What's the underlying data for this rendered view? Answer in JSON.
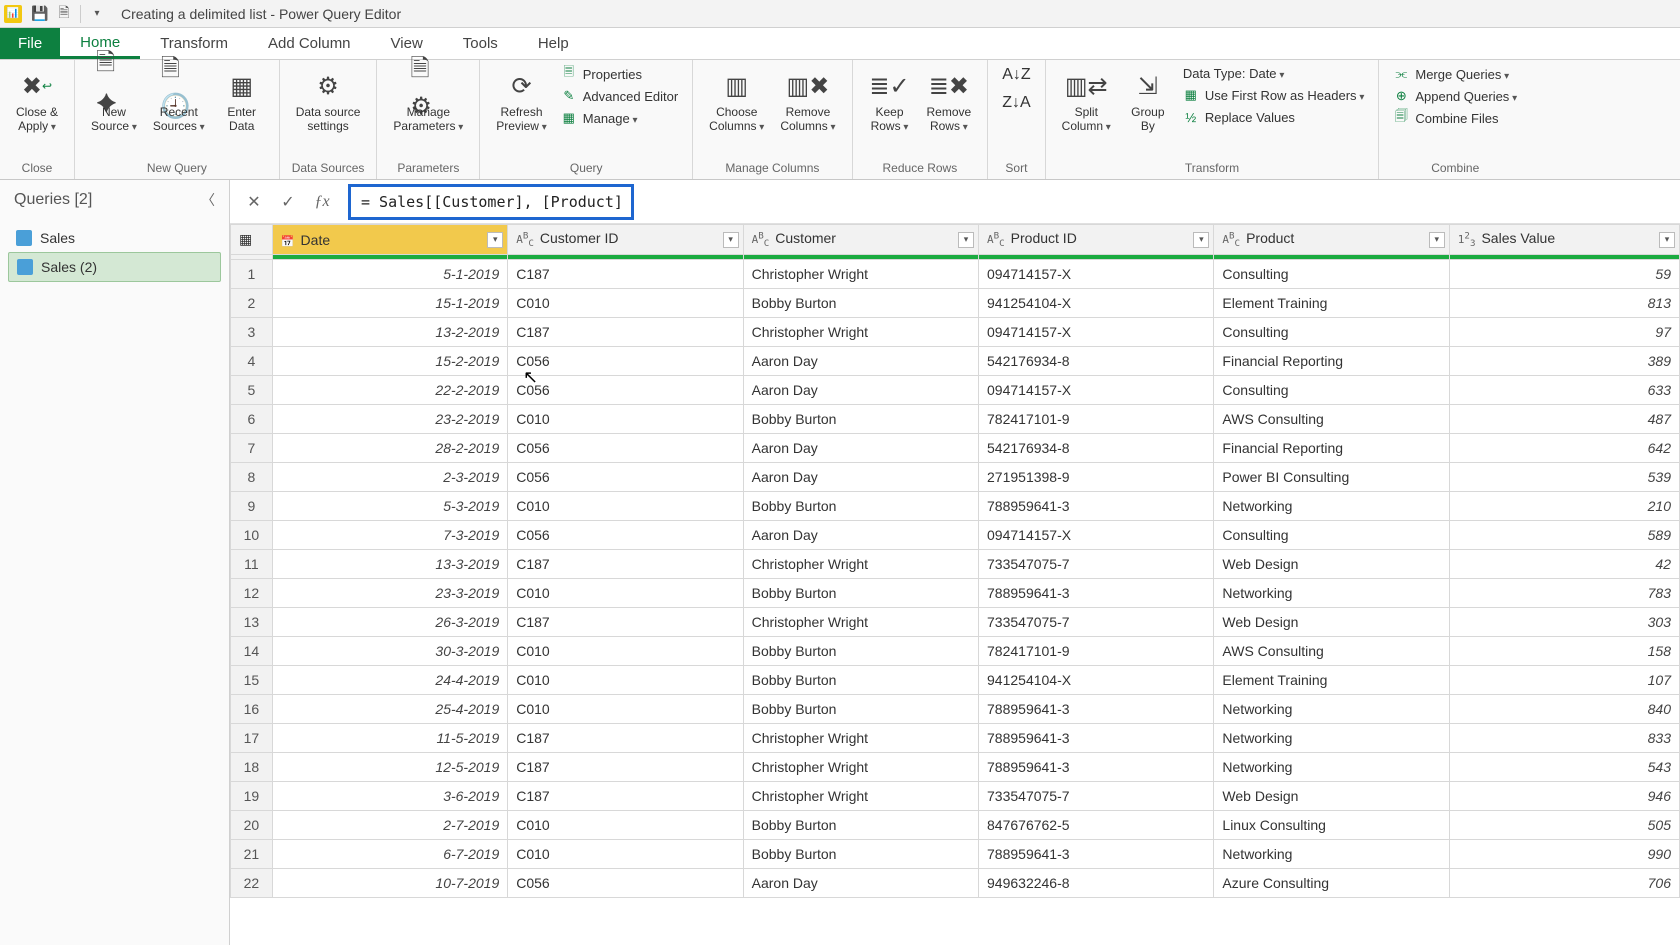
{
  "title": "Creating a delimited list - Power Query Editor",
  "menu": {
    "file": "File",
    "home": "Home",
    "transform": "Transform",
    "addcol": "Add Column",
    "view": "View",
    "tools": "Tools",
    "help": "Help"
  },
  "ribbon": {
    "close_apply": "Close &\nApply",
    "new_source": "New\nSource",
    "recent_sources": "Recent\nSources",
    "enter_data": "Enter\nData",
    "ds_settings": "Data source\nsettings",
    "manage_params": "Manage\nParameters",
    "refresh": "Refresh\nPreview",
    "properties": "Properties",
    "adv_editor": "Advanced Editor",
    "manage": "Manage",
    "choose_cols": "Choose\nColumns",
    "remove_cols": "Remove\nColumns",
    "keep_rows": "Keep\nRows",
    "remove_rows": "Remove\nRows",
    "sort_asc": "",
    "sort_desc": "",
    "split_col": "Split\nColumn",
    "group_by": "Group\nBy",
    "datatype": "Data Type: Date",
    "first_row": "Use First Row as Headers",
    "replace": "Replace Values",
    "merge": "Merge Queries",
    "append": "Append Queries",
    "combine_files": "Combine Files",
    "g_close": "Close",
    "g_newq": "New Query",
    "g_ds": "Data Sources",
    "g_params": "Parameters",
    "g_query": "Query",
    "g_mc": "Manage Columns",
    "g_rr": "Reduce Rows",
    "g_sort": "Sort",
    "g_trans": "Transform",
    "g_combine": "Combine"
  },
  "queries": {
    "header": "Queries [2]",
    "items": [
      "Sales",
      "Sales (2)"
    ],
    "selected": 1
  },
  "formula": "= Sales[[Customer], [Product]]",
  "columns": [
    {
      "key": "date",
      "label": "Date",
      "type": "date",
      "selected": true
    },
    {
      "key": "custid",
      "label": "Customer ID",
      "type": "text"
    },
    {
      "key": "cust",
      "label": "Customer",
      "type": "text"
    },
    {
      "key": "prodid",
      "label": "Product ID",
      "type": "text"
    },
    {
      "key": "prod",
      "label": "Product",
      "type": "text"
    },
    {
      "key": "val",
      "label": "Sales Value",
      "type": "int"
    }
  ],
  "rows": [
    {
      "n": 1,
      "date": "5-1-2019",
      "custid": "C187",
      "cust": "Christopher Wright",
      "prodid": "094714157-X",
      "prod": "Consulting",
      "val": "59"
    },
    {
      "n": 2,
      "date": "15-1-2019",
      "custid": "C010",
      "cust": "Bobby Burton",
      "prodid": "941254104-X",
      "prod": "Element Training",
      "val": "813"
    },
    {
      "n": 3,
      "date": "13-2-2019",
      "custid": "C187",
      "cust": "Christopher Wright",
      "prodid": "094714157-X",
      "prod": "Consulting",
      "val": "97"
    },
    {
      "n": 4,
      "date": "15-2-2019",
      "custid": "C056",
      "cust": "Aaron Day",
      "prodid": "542176934-8",
      "prod": "Financial Reporting",
      "val": "389"
    },
    {
      "n": 5,
      "date": "22-2-2019",
      "custid": "C056",
      "cust": "Aaron Day",
      "prodid": "094714157-X",
      "prod": "Consulting",
      "val": "633"
    },
    {
      "n": 6,
      "date": "23-2-2019",
      "custid": "C010",
      "cust": "Bobby Burton",
      "prodid": "782417101-9",
      "prod": "AWS Consulting",
      "val": "487"
    },
    {
      "n": 7,
      "date": "28-2-2019",
      "custid": "C056",
      "cust": "Aaron Day",
      "prodid": "542176934-8",
      "prod": "Financial Reporting",
      "val": "642"
    },
    {
      "n": 8,
      "date": "2-3-2019",
      "custid": "C056",
      "cust": "Aaron Day",
      "prodid": "271951398-9",
      "prod": "Power BI Consulting",
      "val": "539"
    },
    {
      "n": 9,
      "date": "5-3-2019",
      "custid": "C010",
      "cust": "Bobby Burton",
      "prodid": "788959641-3",
      "prod": "Networking",
      "val": "210"
    },
    {
      "n": 10,
      "date": "7-3-2019",
      "custid": "C056",
      "cust": "Aaron Day",
      "prodid": "094714157-X",
      "prod": "Consulting",
      "val": "589"
    },
    {
      "n": 11,
      "date": "13-3-2019",
      "custid": "C187",
      "cust": "Christopher Wright",
      "prodid": "733547075-7",
      "prod": "Web Design",
      "val": "42"
    },
    {
      "n": 12,
      "date": "23-3-2019",
      "custid": "C010",
      "cust": "Bobby Burton",
      "prodid": "788959641-3",
      "prod": "Networking",
      "val": "783"
    },
    {
      "n": 13,
      "date": "26-3-2019",
      "custid": "C187",
      "cust": "Christopher Wright",
      "prodid": "733547075-7",
      "prod": "Web Design",
      "val": "303"
    },
    {
      "n": 14,
      "date": "30-3-2019",
      "custid": "C010",
      "cust": "Bobby Burton",
      "prodid": "782417101-9",
      "prod": "AWS Consulting",
      "val": "158"
    },
    {
      "n": 15,
      "date": "24-4-2019",
      "custid": "C010",
      "cust": "Bobby Burton",
      "prodid": "941254104-X",
      "prod": "Element Training",
      "val": "107"
    },
    {
      "n": 16,
      "date": "25-4-2019",
      "custid": "C010",
      "cust": "Bobby Burton",
      "prodid": "788959641-3",
      "prod": "Networking",
      "val": "840"
    },
    {
      "n": 17,
      "date": "11-5-2019",
      "custid": "C187",
      "cust": "Christopher Wright",
      "prodid": "788959641-3",
      "prod": "Networking",
      "val": "833"
    },
    {
      "n": 18,
      "date": "12-5-2019",
      "custid": "C187",
      "cust": "Christopher Wright",
      "prodid": "788959641-3",
      "prod": "Networking",
      "val": "543"
    },
    {
      "n": 19,
      "date": "3-6-2019",
      "custid": "C187",
      "cust": "Christopher Wright",
      "prodid": "733547075-7",
      "prod": "Web Design",
      "val": "946"
    },
    {
      "n": 20,
      "date": "2-7-2019",
      "custid": "C010",
      "cust": "Bobby Burton",
      "prodid": "847676762-5",
      "prod": "Linux Consulting",
      "val": "505"
    },
    {
      "n": 21,
      "date": "6-7-2019",
      "custid": "C010",
      "cust": "Bobby Burton",
      "prodid": "788959641-3",
      "prod": "Networking",
      "val": "990"
    },
    {
      "n": 22,
      "date": "10-7-2019",
      "custid": "C056",
      "cust": "Aaron Day",
      "prodid": "949632246-8",
      "prod": "Azure Consulting",
      "val": "706"
    }
  ]
}
